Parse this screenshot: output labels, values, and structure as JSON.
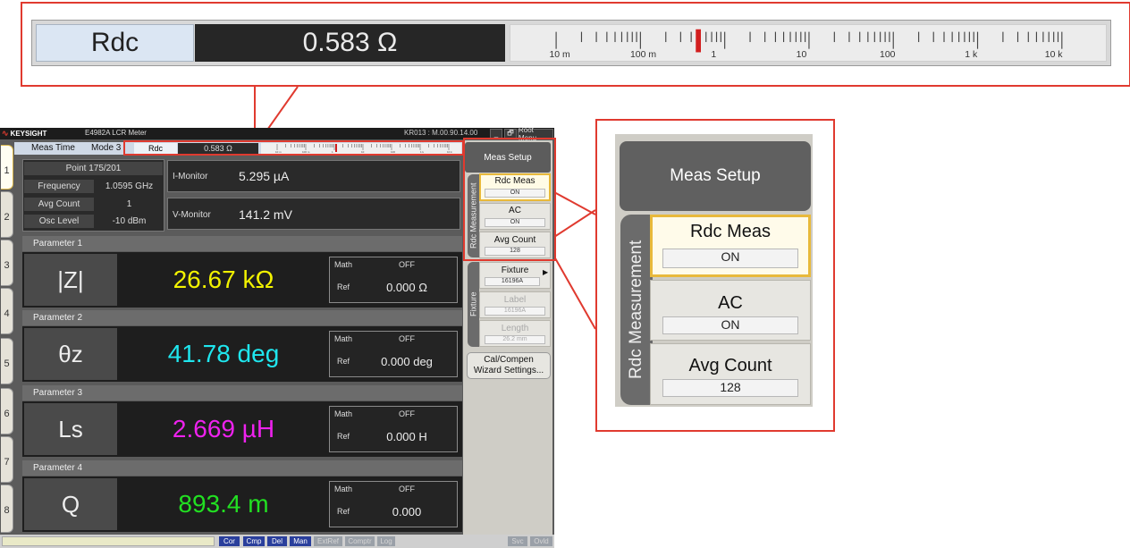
{
  "zoom": {
    "label": "Rdc",
    "value": "0.583 Ω",
    "scale_labels": [
      "10 m",
      "100 m",
      "1",
      "10",
      "100",
      "1 k",
      "10 k"
    ]
  },
  "titlebar": {
    "brand": "KEYSIGHT",
    "title": "E4982A LCR Meter",
    "firmware": "KR013 : M.00.90.14.00",
    "minimize": "_",
    "restore": "🗗",
    "root_menu": "Root Menu"
  },
  "toolbar": {
    "meas_time": "Meas Time",
    "mode": "Mode 3",
    "rdc_label": "Rdc",
    "rdc_value": "0.583 Ω",
    "mini_scale_labels": [
      "10 m",
      "100 m",
      "1",
      "10",
      "100",
      "1 k",
      "10 k"
    ]
  },
  "tabs": [
    "1",
    "2",
    "3",
    "4",
    "5",
    "6",
    "7",
    "8"
  ],
  "info": {
    "point": "Point 175/201",
    "rows": [
      {
        "key": "Frequency",
        "value": "1.0595 GHz"
      },
      {
        "key": "Avg Count",
        "value": "1"
      },
      {
        "key": "Osc Level",
        "value": "-10 dBm"
      }
    ]
  },
  "monitors": [
    {
      "key": "I-Monitor",
      "value": "5.295 µA"
    },
    {
      "key": "V-Monitor",
      "value": "141.2 mV"
    }
  ],
  "params": [
    {
      "header": "Parameter 1",
      "name": "|Z|",
      "value": "26.67 kΩ",
      "color": "#f2f200",
      "math_label": "Math",
      "math": "OFF",
      "ref_label": "Ref",
      "ref": "0.000 Ω"
    },
    {
      "header": "Parameter 2",
      "name": "θz",
      "value": "41.78 deg",
      "color": "#1fe6ee",
      "math_label": "Math",
      "math": "OFF",
      "ref_label": "Ref",
      "ref": "0.000 deg"
    },
    {
      "header": "Parameter 3",
      "name": "Ls",
      "value": "2.669 µH",
      "color": "#ee22ee",
      "math_label": "Math",
      "math": "OFF",
      "ref_label": "Ref",
      "ref": "0.000 H"
    },
    {
      "header": "Parameter 4",
      "name": "Q",
      "value": "893.4 m",
      "color": "#22e022",
      "math_label": "Math",
      "math": "OFF",
      "ref_label": "Ref",
      "ref": "0.000"
    }
  ],
  "softkeys": {
    "title": "Meas Setup",
    "group_rdc": "Rdc Measurement",
    "group_fixture": "Fixture",
    "rdc_meas": {
      "label": "Rdc Meas",
      "value": "ON"
    },
    "ac": {
      "label": "AC",
      "value": "ON"
    },
    "avg_count": {
      "label": "Avg Count",
      "value": "128"
    },
    "fixture": {
      "label": "Fixture",
      "value": "16196A"
    },
    "label": {
      "label": "Label",
      "value": "16196A"
    },
    "length": {
      "label": "Length",
      "value": "26.2 mm"
    },
    "cal": {
      "line1": "Cal/Compen",
      "line2": "Wizard Settings..."
    }
  },
  "status": {
    "items": [
      {
        "text": "Cor",
        "on": true
      },
      {
        "text": "Cmp",
        "on": true
      },
      {
        "text": "Del",
        "on": true
      },
      {
        "text": "Man",
        "on": true
      },
      {
        "text": "ExtRef",
        "on": false
      },
      {
        "text": "Comptr",
        "on": false
      },
      {
        "text": "Log",
        "on": false
      }
    ],
    "svc": "Svc",
    "ovld": "Ovld"
  },
  "colors": {
    "accent_red": "#e03a2f",
    "highlight": "#e8b93b"
  }
}
